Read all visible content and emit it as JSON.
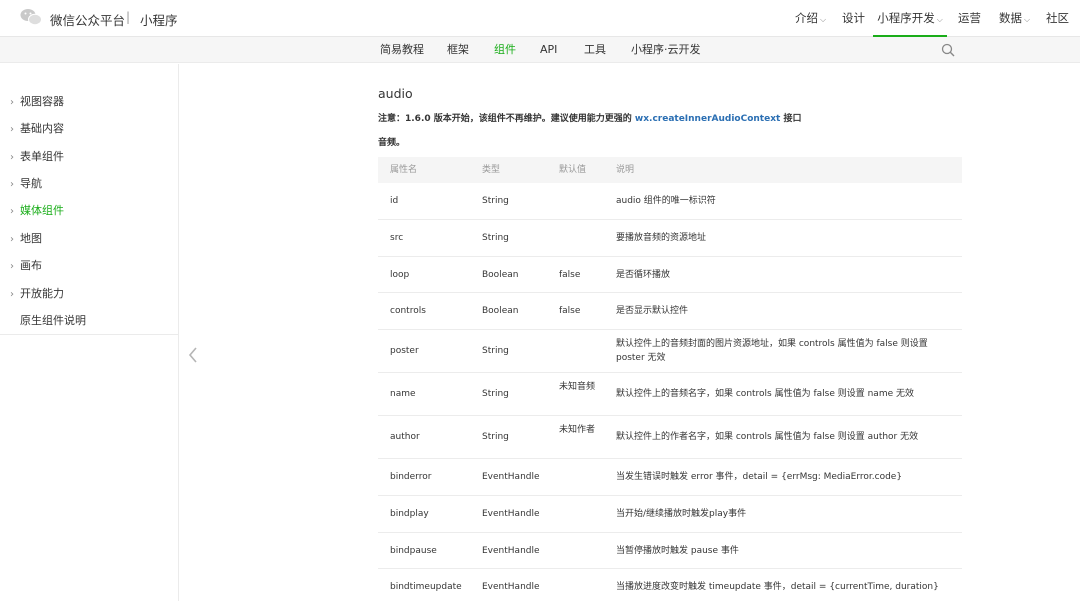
{
  "header": {
    "brand": "微信公众平台",
    "separator": "|",
    "subtitle": "小程序",
    "nav": [
      {
        "label": "介绍",
        "dropdown": true
      },
      {
        "label": "设计",
        "dropdown": false
      },
      {
        "label": "小程序开发",
        "dropdown": true,
        "active": true
      },
      {
        "label": "运营",
        "dropdown": false
      },
      {
        "label": "数据",
        "dropdown": true
      },
      {
        "label": "社区",
        "dropdown": false
      }
    ],
    "dropdown_glyph": "⌵"
  },
  "subnav": {
    "items": [
      {
        "label": "简易教程"
      },
      {
        "label": "框架"
      },
      {
        "label": "组件",
        "active": true
      },
      {
        "label": "API"
      },
      {
        "label": "工具"
      },
      {
        "label": "小程序·云开发"
      }
    ]
  },
  "sidebar": {
    "chevron": "›",
    "items": [
      {
        "label": "视图容器",
        "chevron": true
      },
      {
        "label": "基础内容",
        "chevron": true
      },
      {
        "label": "表单组件",
        "chevron": true
      },
      {
        "label": "导航",
        "chevron": true
      },
      {
        "label": "媒体组件",
        "chevron": true,
        "active": true
      },
      {
        "label": "地图",
        "chevron": true
      },
      {
        "label": "画布",
        "chevron": true
      },
      {
        "label": "开放能力",
        "chevron": true
      },
      {
        "label": "原生组件说明",
        "chevron": false
      }
    ]
  },
  "main": {
    "title": "audio",
    "note_prefix": "注意：1.6.0 版本开始，该组件不再维护。建议使用能力更强的 ",
    "note_link": "wx.createInnerAudioContext",
    "note_suffix": " 接口",
    "description": "音频。",
    "table": {
      "headers": [
        "属性名",
        "类型",
        "默认值",
        "说明"
      ],
      "rows": [
        [
          "id",
          "String",
          "",
          "audio 组件的唯一标识符"
        ],
        [
          "src",
          "String",
          "",
          "要播放音频的资源地址"
        ],
        [
          "loop",
          "Boolean",
          "false",
          "是否循环播放"
        ],
        [
          "controls",
          "Boolean",
          "false",
          "是否显示默认控件"
        ],
        [
          "poster",
          "String",
          "",
          "默认控件上的音频封面的图片资源地址，如果 controls 属性值为 false 则设置 poster 无效"
        ],
        [
          "name",
          "String",
          "未知音频",
          "默认控件上的音频名字，如果 controls 属性值为 false 则设置 name 无效"
        ],
        [
          "author",
          "String",
          "未知作者",
          "默认控件上的作者名字，如果 controls 属性值为 false 则设置 author 无效"
        ],
        [
          "binderror",
          "EventHandle",
          "",
          "当发生错误时触发 error 事件，detail = {errMsg: MediaError.code}"
        ],
        [
          "bindplay",
          "EventHandle",
          "",
          "当开始/继续播放时触发play事件"
        ],
        [
          "bindpause",
          "EventHandle",
          "",
          "当暂停播放时触发 pause 事件"
        ],
        [
          "bindtimeupdate",
          "EventHandle",
          "",
          "当播放进度改变时触发 timeupdate 事件，detail = {currentTime, duration}"
        ]
      ]
    }
  },
  "colors": {
    "accent": "#1aad19",
    "link": "#2b6fb3"
  }
}
